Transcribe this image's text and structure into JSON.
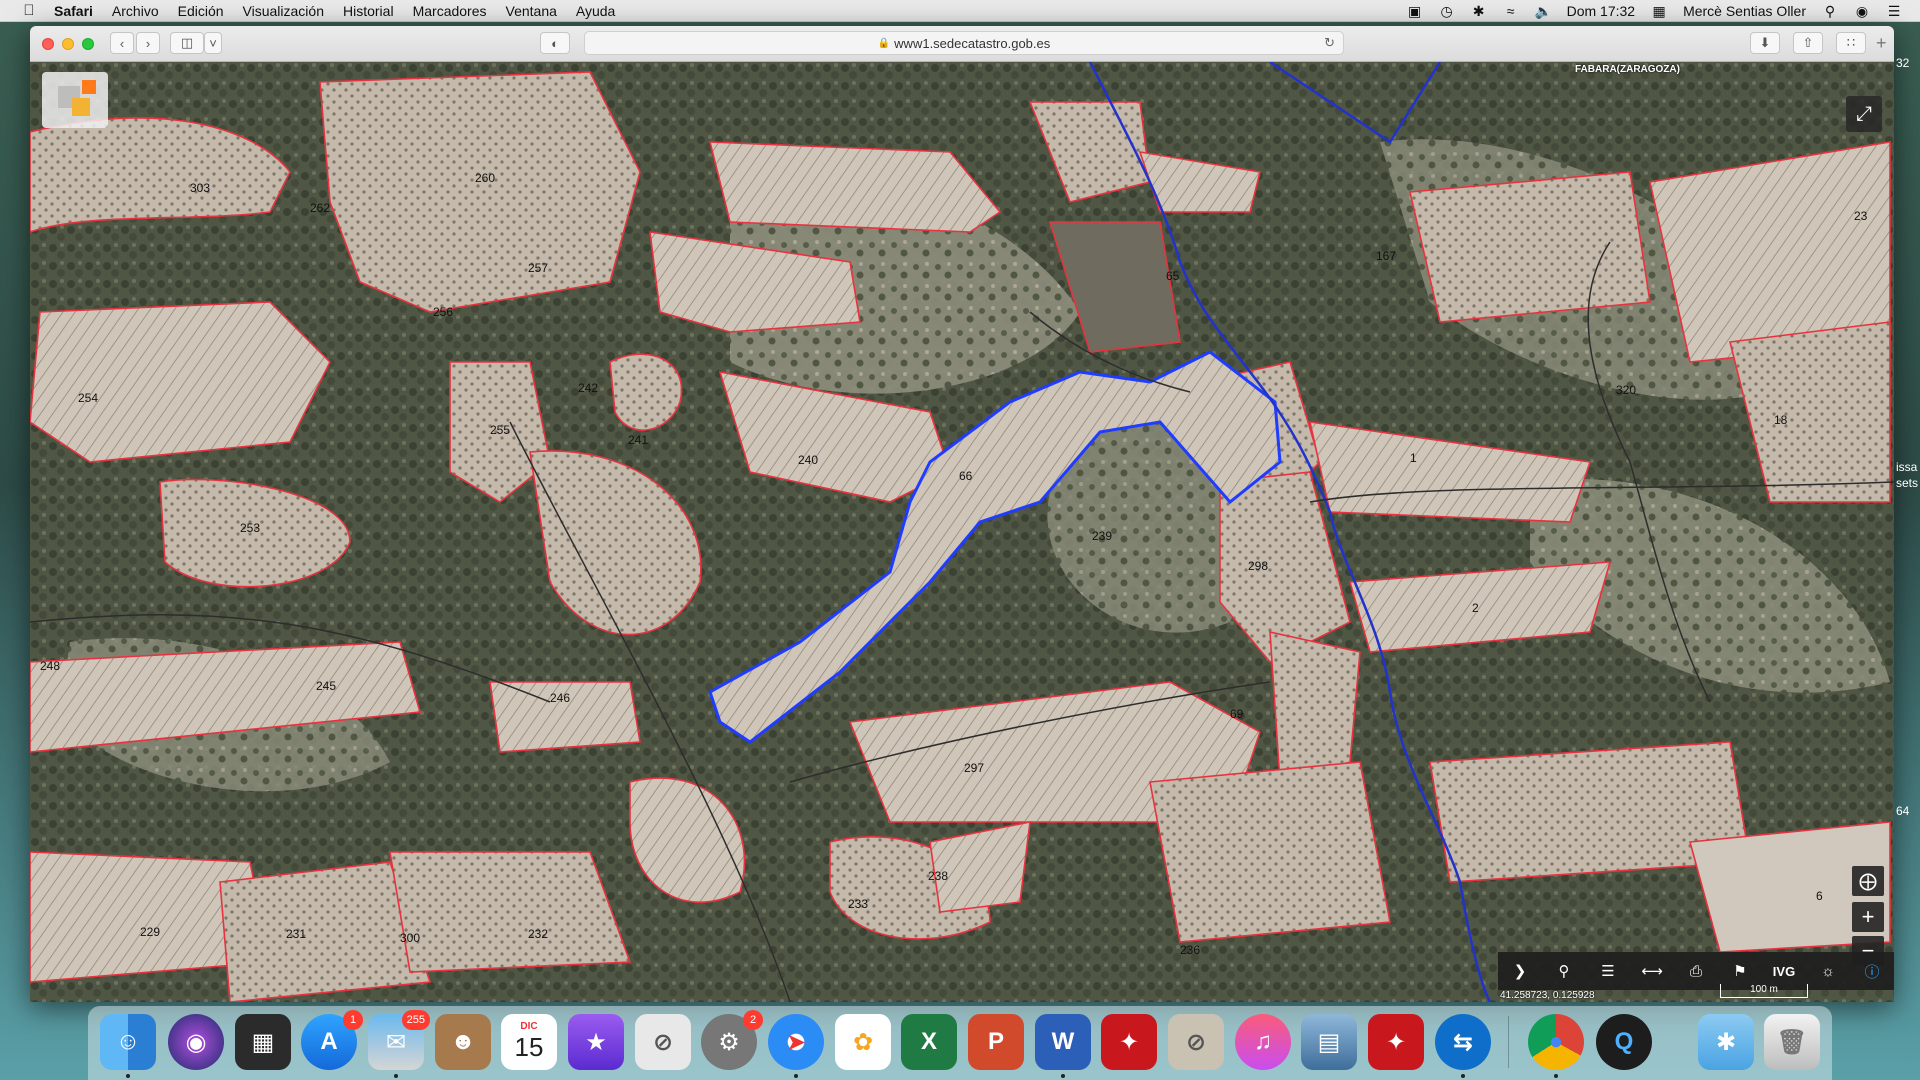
{
  "menubar": {
    "app": "Safari",
    "items": [
      "Archivo",
      "Edición",
      "Visualización",
      "Historial",
      "Marcadores",
      "Ventana",
      "Ayuda"
    ],
    "clock": "Dom 17:32",
    "user": "Mercè Sentias Oller"
  },
  "browser": {
    "url": "www1.sedecatastro.gob.es"
  },
  "map": {
    "region_label": "FABARA(ZARAGOZA)",
    "coordinates": "41.258723, 0.125928",
    "scale_label": "100 m",
    "ivg_label": "IVG",
    "parcel_labels": [
      "303",
      "262",
      "260",
      "257",
      "256",
      "254",
      "255",
      "242",
      "241",
      "240",
      "66",
      "65",
      "253",
      "239",
      "298",
      "245",
      "248",
      "246",
      "297",
      "69",
      "238",
      "233",
      "231",
      "229",
      "300",
      "232",
      "236",
      "1",
      "2",
      "18",
      "167",
      "320",
      "23",
      "6"
    ]
  },
  "side_strip": {
    "top_number": "32",
    "mid_text_1": "issa",
    "mid_text_2": "sets",
    "bottom_text": "64"
  },
  "dock": {
    "calendar_month": "DIC",
    "calendar_day": "15",
    "badges": {
      "app_store": "1",
      "mail": "255",
      "system_prefs": "2"
    }
  },
  "colors": {
    "parcel_outline": "#e8333f",
    "selected_parcel": "#1f3cff",
    "boundary_line": "#2233cc"
  }
}
